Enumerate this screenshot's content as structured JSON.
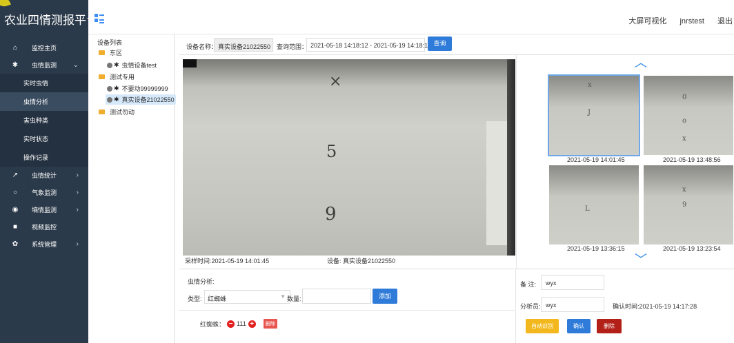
{
  "app": {
    "title": "农业四情测报平台"
  },
  "topbar": {
    "links": [
      "大屏可视化",
      "jnrstest",
      "退出"
    ]
  },
  "sidebar": {
    "items": [
      {
        "label": "监控主页",
        "icon": "home-icon"
      },
      {
        "label": "虫情监测",
        "icon": "bug-icon"
      },
      {
        "label": "实时虫情"
      },
      {
        "label": "虫情分析"
      },
      {
        "label": "害虫种类"
      },
      {
        "label": "实时状态"
      },
      {
        "label": "操作记录"
      },
      {
        "label": "虫情统计",
        "icon": "chart-icon"
      },
      {
        "label": "气象监测",
        "icon": "weather-icon"
      },
      {
        "label": "墒情监测",
        "icon": "soil-icon"
      },
      {
        "label": "视频监控",
        "icon": "video-icon"
      },
      {
        "label": "系统管理",
        "icon": "gear-icon"
      }
    ]
  },
  "tree": {
    "header": "设备列表",
    "nodes": [
      "东区",
      "虫情设备test",
      "测试专用",
      "不要动99999999",
      "真实设备21022550",
      "测试勿动"
    ]
  },
  "filter": {
    "device_label": "设备名称：",
    "device_value": "真实设备21022550",
    "range_label": "查询范围：",
    "range_value": "2021-05-18 14:18:12 - 2021-05-19 14:18:12",
    "query_button": "查询"
  },
  "main": {
    "sample_time": "采样时间:2021-05-19 14:01:45",
    "device_caption": "设备: 真实设备21022550"
  },
  "thumbs": [
    "2021-05-19 14:01:45",
    "2021-05-19 13:48:56",
    "2021-05-19 13:36:15",
    "2021-05-19 13:23:54"
  ],
  "analysis": {
    "title": "虫情分析:",
    "type_label": "类型:",
    "type_value": "红蜘蛛",
    "qty_label": "数量:",
    "add_button": "添加",
    "pest_name": "红蜘蛛：",
    "pest_count": "111",
    "delete_small": "删除"
  },
  "form": {
    "note_label": "备 注:",
    "note_value": "wyx",
    "analyst_label": "分析员:",
    "analyst_value": "wyx",
    "confirm_time": "确认时间:2021-05-19 14:17:28",
    "btn_auto": "自动识别",
    "btn_confirm": "确认",
    "btn_delete": "删除"
  }
}
